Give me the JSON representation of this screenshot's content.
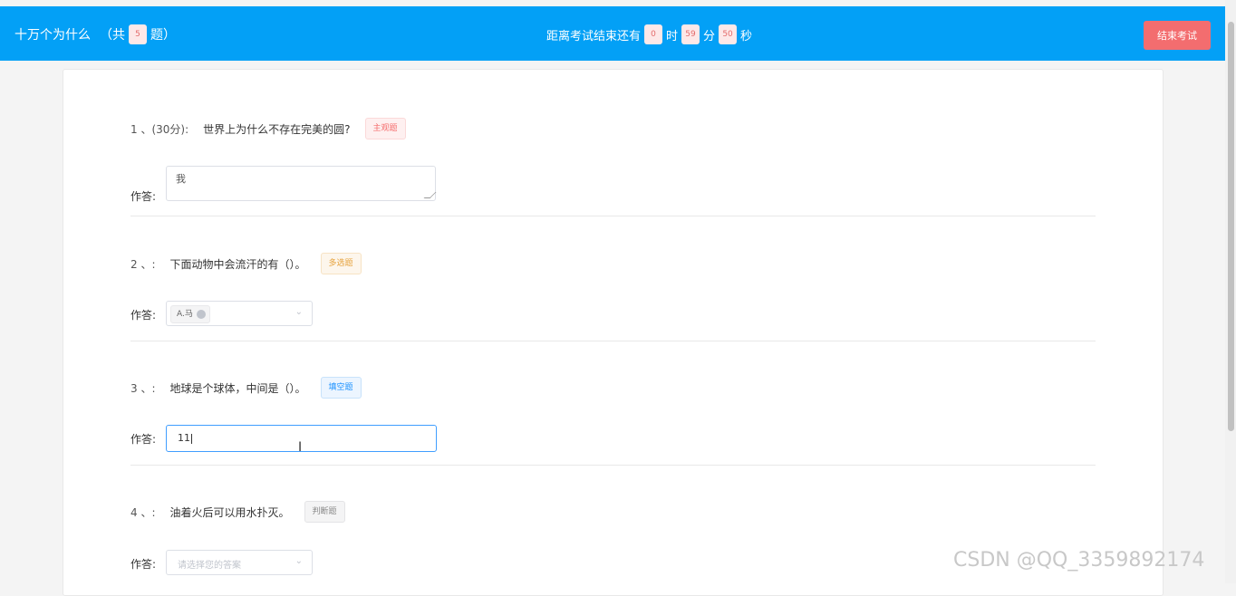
{
  "header": {
    "title": "十万个为什么",
    "count_prefix": "（共",
    "count": "5",
    "count_suffix": "题）",
    "timer_label": "距离考试结束还有",
    "hours": "0",
    "hours_unit": "时",
    "minutes": "59",
    "minutes_unit": "分",
    "seconds": "50",
    "seconds_unit": "秒",
    "end_button": "结束考试"
  },
  "answer_label": "作答:",
  "questions": [
    {
      "number": "1 、(30分):",
      "text": "世界上为什么不存在完美的圆?",
      "tag": "主观题",
      "answer": "我"
    },
    {
      "number": "2 、:",
      "text": "下面动物中会流汗的有（）。",
      "tag": "多选题",
      "selected": "A.马"
    },
    {
      "number": "3 、:",
      "text": "地球是个球体，中间是（）。",
      "tag": "填空题",
      "answer": "11"
    },
    {
      "number": "4 、:",
      "text": "油着火后可以用水扑灭。",
      "tag": "判断题",
      "placeholder": "请选择您的答案"
    }
  ],
  "watermark": "CSDN @QQ_3359892174",
  "colors": {
    "header_bg": "#03a0f6",
    "end_button": "#f36d6f",
    "focus_border": "#409eff"
  }
}
